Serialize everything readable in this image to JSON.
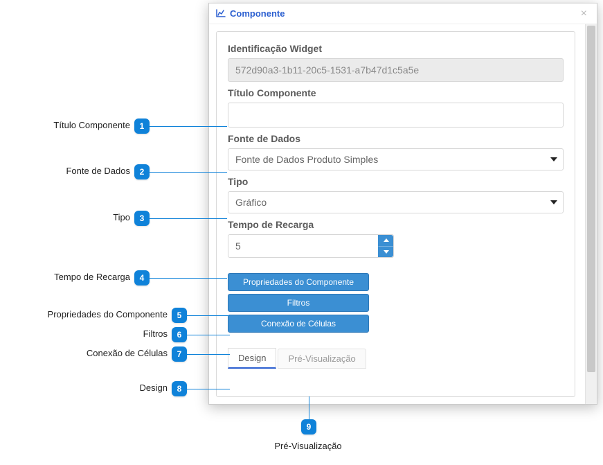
{
  "modal": {
    "title": "Componente"
  },
  "fields": {
    "widget_id_label": "Identificação Widget",
    "widget_id_value": "572d90a3-1b11-20c5-1531-a7b47d1c5a5e",
    "titulo_label": "Título Componente",
    "titulo_value": "",
    "fonte_label": "Fonte de Dados",
    "fonte_value": "Fonte de Dados Produto Simples",
    "tipo_label": "Tipo",
    "tipo_value": "Gráfico",
    "recarga_label": "Tempo de Recarga",
    "recarga_value": "5"
  },
  "buttons": {
    "props": "Propriedades do Componente",
    "filtros": "Filtros",
    "conexao": "Conexão de Células"
  },
  "tabs": {
    "design": "Design",
    "preview": "Pré-Visualização"
  },
  "callouts": {
    "c1": {
      "num": "1",
      "label": "Título Componente"
    },
    "c2": {
      "num": "2",
      "label": "Fonte de Dados"
    },
    "c3": {
      "num": "3",
      "label": "Tipo"
    },
    "c4": {
      "num": "4",
      "label": "Tempo de Recarga"
    },
    "c5": {
      "num": "5",
      "label": "Propriedades do Componente"
    },
    "c6": {
      "num": "6",
      "label": "Filtros"
    },
    "c7": {
      "num": "7",
      "label": "Conexão de Células"
    },
    "c8": {
      "num": "8",
      "label": "Design"
    },
    "c9": {
      "num": "9",
      "label": "Pré-Visualização"
    }
  }
}
